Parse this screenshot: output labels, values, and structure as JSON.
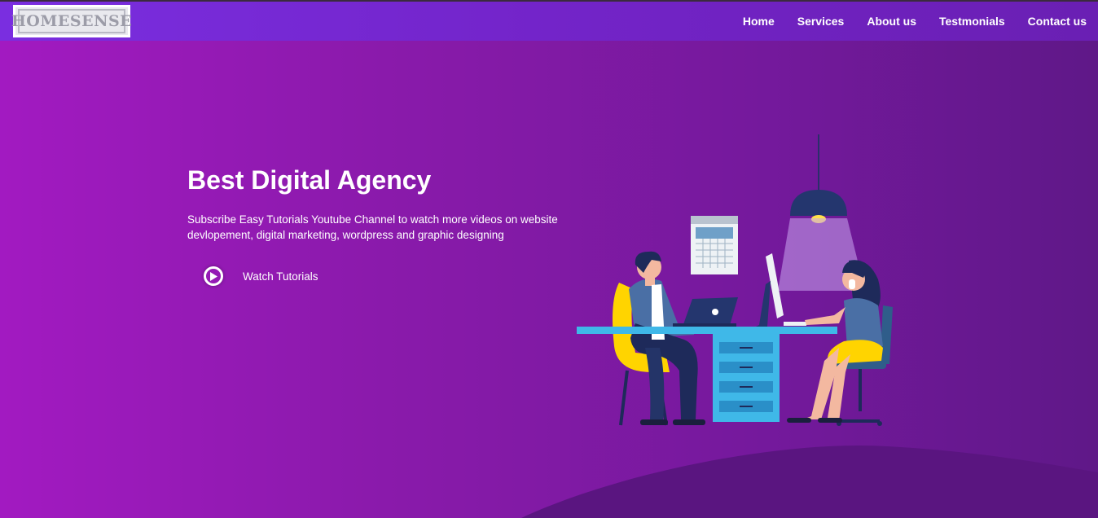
{
  "brand": {
    "logo_text": "HOMESENSE"
  },
  "nav": {
    "items": [
      {
        "label": "Home"
      },
      {
        "label": "Services"
      },
      {
        "label": "About us"
      },
      {
        "label": "Testmonials"
      },
      {
        "label": "Contact us"
      }
    ]
  },
  "hero": {
    "title": "Best Digital Agency",
    "subtitle": "Subscribe Easy Tutorials Youtube Channel to watch more videos on website devlopement, digital marketing, wordpress and graphic designing",
    "cta": {
      "label": "Watch Tutorials",
      "icon": "play-circle-icon"
    }
  },
  "colors": {
    "background_start": "#a21ac1",
    "background_end": "#5f1888",
    "navbar": "#7324c9",
    "wave": "#5a1580",
    "desk_accent": "#3fb8e8",
    "chair_yellow": "#ffd400",
    "character_navy": "#1e2a5a"
  }
}
